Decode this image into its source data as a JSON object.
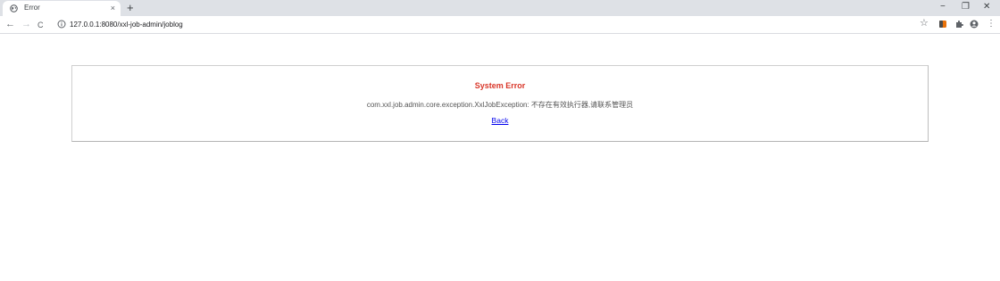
{
  "browser": {
    "tab": {
      "title": "Error",
      "favicon": "globe-icon",
      "close": "×"
    },
    "new_tab": "+",
    "window_controls": {
      "minimize": "−",
      "restore": "❐",
      "close": "✕"
    },
    "nav": {
      "back": "←",
      "forward": "→",
      "reload": "C"
    },
    "url": "127.0.0.1:8080/xxl-job-admin/joblog",
    "toolbar_icons": [
      "star-icon",
      "extension-shield-icon",
      "puzzle-icon",
      "account-icon",
      "menu-icon"
    ],
    "menu_glyph": "⋮",
    "star_glyph": "☆"
  },
  "page": {
    "title": "System Error",
    "message": "com.xxl.job.admin.core.exception.XxlJobException: 不存在有效执行器,请联系管理员",
    "back_link": "Back",
    "title_color": "#d9372a",
    "link_color": "#0000ee"
  }
}
